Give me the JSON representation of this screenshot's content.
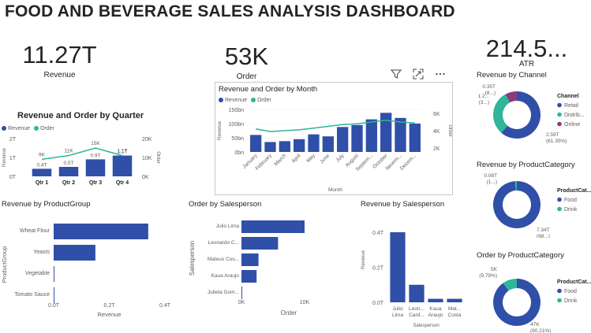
{
  "title": "FOOD AND BEVERAGE SALES ANALYSIS DASHBOARD",
  "kpis": [
    {
      "value": "11.27T",
      "label": "Revenue"
    },
    {
      "value": "53K",
      "label": "Order"
    },
    {
      "value": "214.5...",
      "label": "ATR"
    }
  ],
  "colors": {
    "revenue": "#2f4fa8",
    "order": "#2fb59a",
    "online": "#8a3c7c",
    "panel_border": "#c8c8c8"
  },
  "toolbar": {
    "icons": [
      "filter-icon",
      "focus-mode-icon",
      "more-options-icon"
    ]
  },
  "chart_data": [
    {
      "id": "quarter",
      "type": "bar",
      "title": "Revenue and Order by Quarter",
      "legend": [
        "Revenue",
        "Order"
      ],
      "categories": [
        "Qtr 1",
        "Qtr 2",
        "Qtr 3",
        "Qtr 4"
      ],
      "series": [
        {
          "name": "Revenue",
          "values": [
            0.4,
            0.5,
            0.9,
            1.1
          ],
          "labels": [
            "0.4T",
            "0.5T",
            "0.9T",
            "1.1T"
          ]
        },
        {
          "name": "Order",
          "values": [
            9,
            11,
            15,
            11
          ],
          "labels": [
            "9K",
            "11K",
            "15K",
            "1.1T"
          ]
        }
      ],
      "ylabel": "Revenue",
      "y2label": "Order",
      "yticks": [
        "2T",
        "1T",
        "0T"
      ],
      "y2ticks": [
        "20K",
        "10K",
        "0K"
      ],
      "ylim": [
        0,
        2
      ],
      "y2lim": [
        0,
        20
      ]
    },
    {
      "id": "month",
      "type": "bar",
      "title": "Revenue and Order by Month",
      "legend": [
        "Revenue",
        "Order"
      ],
      "categories": [
        "January",
        "February",
        "March",
        "April",
        "May",
        "June",
        "July",
        "August",
        "Septem...",
        "October",
        "Novem...",
        "Decem..."
      ],
      "series": [
        {
          "name": "Revenue",
          "values": [
            60,
            35,
            38,
            45,
            62,
            55,
            88,
            95,
            115,
            138,
            120,
            100
          ]
        },
        {
          "name": "Order",
          "values": [
            4.2,
            3.9,
            4.0,
            4.1,
            4.3,
            4.5,
            4.7,
            4.8,
            5.0,
            5.2,
            5.0,
            4.9
          ]
        }
      ],
      "xlabel": "Month",
      "ylabel": "Revenue",
      "y2label": "Order",
      "yticks": [
        "150bn",
        "100bn",
        "50bn",
        "0bn"
      ],
      "y2ticks": [
        "6K",
        "4K",
        "2K"
      ],
      "ylim": [
        0,
        150
      ],
      "y2lim": [
        2,
        6
      ]
    },
    {
      "id": "channel",
      "type": "pie",
      "title": "Revenue by Channel",
      "legend_title": "Channel",
      "legend": [
        "Retail",
        "Distrib...",
        "Online"
      ],
      "values": [
        61.35,
        30.5,
        8.15
      ],
      "labels": [
        "2.59T (61.35%)",
        "1.2... (3...)",
        "0.35T (8...)"
      ]
    },
    {
      "id": "productcategory_rev",
      "type": "pie",
      "title": "Revenue by ProductCategory",
      "legend_title": "ProductCat...",
      "legend": [
        "Food",
        "Drink"
      ],
      "values": [
        98.9,
        1.1
      ],
      "labels": [
        "7.34T (98...)",
        "0.08T (1...)"
      ]
    },
    {
      "id": "productgroup",
      "type": "bar",
      "title": "Revenue by ProductGroup",
      "categories": [
        "Wheat Flour",
        "Yeasts",
        "Vegetable",
        "Tomato Sauce"
      ],
      "values": [
        3.4,
        1.5,
        0.02,
        0.01
      ],
      "xlabel": "Revenue",
      "ylabel": "ProductGroup",
      "xticks": [
        "0.0T",
        "0.2T",
        "0.4T"
      ]
    },
    {
      "id": "order_salesperson",
      "type": "bar",
      "title": "Order by Salesperson",
      "categories": [
        "Julio Lima",
        "Leonardo C...",
        "Mateus Cos...",
        "Kaua Araujo",
        "Julieta Gom..."
      ],
      "values": [
        10,
        5.8,
        2.7,
        2.4,
        0.1
      ],
      "xlabel": "Order",
      "ylabel": "Salesperson",
      "xticks": [
        "0K",
        "10K"
      ]
    },
    {
      "id": "revenue_salesperson",
      "type": "bar",
      "title": "Revenue by Salesperson",
      "categories": [
        "Julio Lima",
        "Leon... Card...",
        "Kaua Araujo",
        "Mat... Costa"
      ],
      "values": [
        0.4,
        0.1,
        0.02,
        0.02
      ],
      "xlabel": "Salesperson",
      "ylabel": "Revenue",
      "yticks": [
        "0.4T",
        "0.2T",
        "0.0T"
      ]
    },
    {
      "id": "productcategory_order",
      "type": "pie",
      "title": "Order by ProductCategory",
      "legend_title": "ProductCat...",
      "legend": [
        "Food",
        "Drink"
      ],
      "values": [
        90.21,
        9.79
      ],
      "labels": [
        "47K (90.21%)",
        "5K (9.79%)"
      ]
    }
  ]
}
